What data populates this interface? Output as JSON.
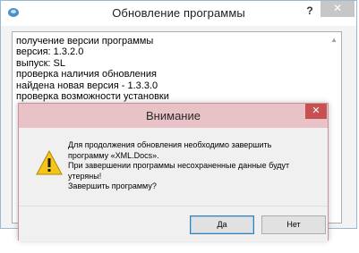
{
  "main_window": {
    "title": "Обновление программы",
    "help_glyph": "?",
    "close_glyph": "✕",
    "log_lines": [
      "получение версии программы",
      "версия: 1.3.2.0",
      "выпуск: SL",
      "проверка наличия обновления",
      "найдена новая версия - 1.3.3.0",
      "проверка возможности установки"
    ]
  },
  "dialog": {
    "title": "Внимание",
    "close_glyph": "✕",
    "icon": "warning-icon",
    "message_lines": [
      "Для продолжения обновления необходимо завершить",
      "программу «XML.Docs».",
      "При завершении программы несохраненные данные будут",
      "утеряны!",
      "Завершить программу?"
    ],
    "buttons": {
      "yes": "Да",
      "no": "Нет"
    }
  },
  "colors": {
    "dialog_title_bg": "#e8c2c7",
    "dialog_close_bg": "#c75050",
    "warning_yellow": "#f5c518"
  }
}
